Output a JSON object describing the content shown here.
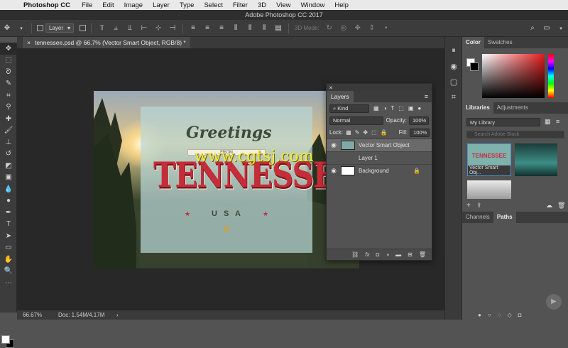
{
  "menubar": {
    "app": "Photoshop CC",
    "items": [
      "File",
      "Edit",
      "Image",
      "Layer",
      "Type",
      "Select",
      "Filter",
      "3D",
      "View",
      "Window",
      "Help"
    ]
  },
  "window": {
    "title": "Adobe Photoshop CC 2017"
  },
  "options": {
    "auto_select_target": "Layer",
    "mode_3d": "3D Mode:"
  },
  "document": {
    "tab_title": "tennessee.psd @ 66.7% (Vector Smart Object, RGB/8) *",
    "close": "×"
  },
  "artwork": {
    "greetings": "Greetings",
    "from": "FROM",
    "state": "TENNESSEE",
    "country": "U S A"
  },
  "watermark": "www.cgtsj.com",
  "status": {
    "zoom": "66.67%",
    "doc": "Doc: 1.54M/4.17M",
    "arrow": "›"
  },
  "layers_panel": {
    "title": "Layers",
    "filter": "Kind",
    "blend_mode": "Normal",
    "opacity_label": "Opacity:",
    "opacity_value": "100%",
    "lock_label": "Lock:",
    "fill_label": "Fill:",
    "fill_value": "100%",
    "layers": [
      {
        "name": "Vector Smart Object",
        "selected": true
      },
      {
        "name": "Layer 1",
        "selected": false
      },
      {
        "name": "Background",
        "selected": false
      }
    ]
  },
  "color_panel": {
    "tabs": [
      "Color",
      "Swatches"
    ]
  },
  "libraries_panel": {
    "tabs": [
      "Libraries",
      "Adjustments"
    ],
    "library": "My Library",
    "search_placeholder": "Search Adobe Stock",
    "asset_label": "Vector Smart Obj..."
  },
  "paths_panel": {
    "tabs": [
      "Channels",
      "Paths"
    ]
  },
  "colors": {
    "accent_red": "#c62d3a",
    "swatch_fg": "#ffffff",
    "swatch_bg": "#000000"
  }
}
